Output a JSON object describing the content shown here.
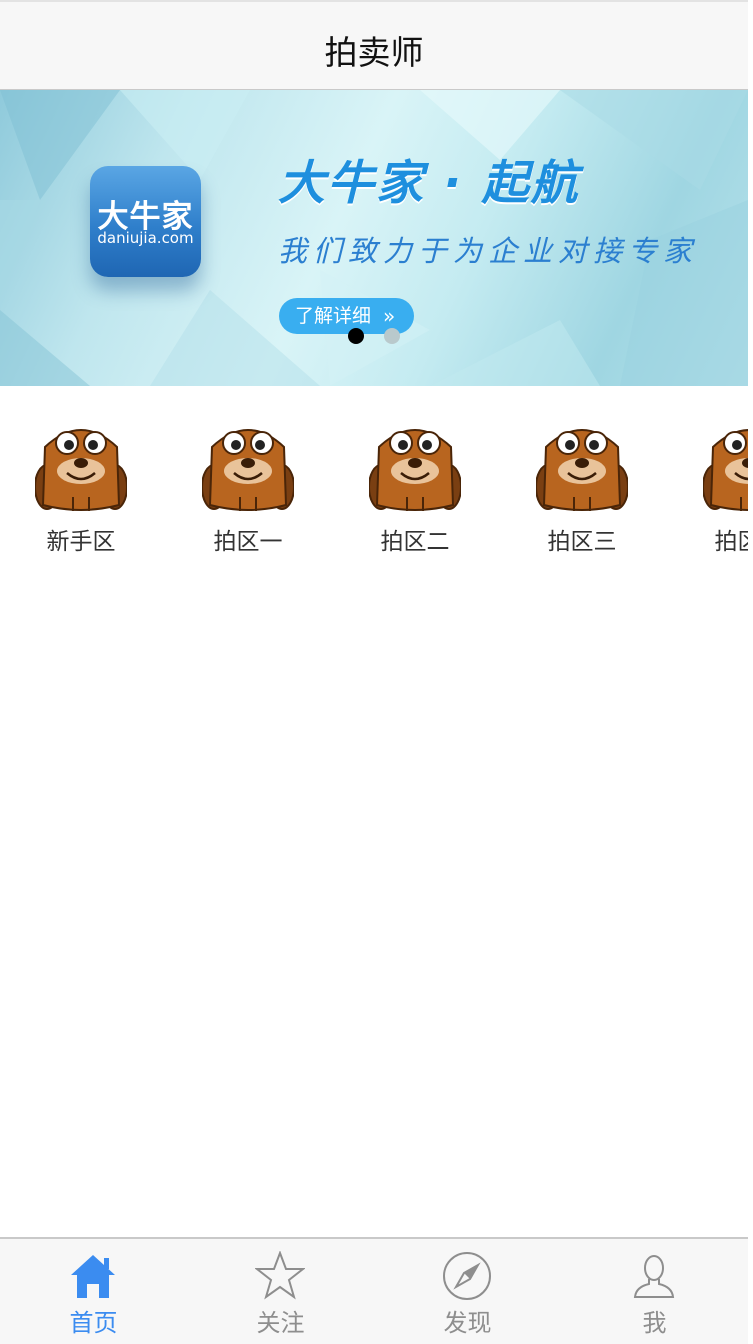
{
  "header": {
    "title": "拍卖师"
  },
  "banner": {
    "app_name": "大牛家",
    "app_domain": "daniujia.com",
    "headline": "大牛家 · 起航",
    "slogan": "我们致力于为企业对接专家",
    "more_label": "了解详细",
    "more_arrow": "»",
    "slide_count": 2,
    "active_slide": 1
  },
  "categories": [
    {
      "label": "新手区",
      "icon": "bear-avatar-icon"
    },
    {
      "label": "拍区一",
      "icon": "bear-avatar-icon"
    },
    {
      "label": "拍区二",
      "icon": "bear-avatar-icon"
    },
    {
      "label": "拍区三",
      "icon": "bear-avatar-icon"
    },
    {
      "label": "拍区四",
      "icon": "bear-avatar-icon"
    }
  ],
  "tabbar": {
    "items": [
      {
        "label": "首页",
        "icon": "home-icon",
        "active": true
      },
      {
        "label": "关注",
        "icon": "star-icon",
        "active": false
      },
      {
        "label": "发现",
        "icon": "compass-icon",
        "active": false
      },
      {
        "label": "我",
        "icon": "user-icon",
        "active": false
      }
    ]
  },
  "colors": {
    "accent": "#3b8cf0",
    "tab_inactive": "#8e8e8e",
    "bar_bg": "#f7f7f7",
    "banner_button": "#39aef0"
  }
}
